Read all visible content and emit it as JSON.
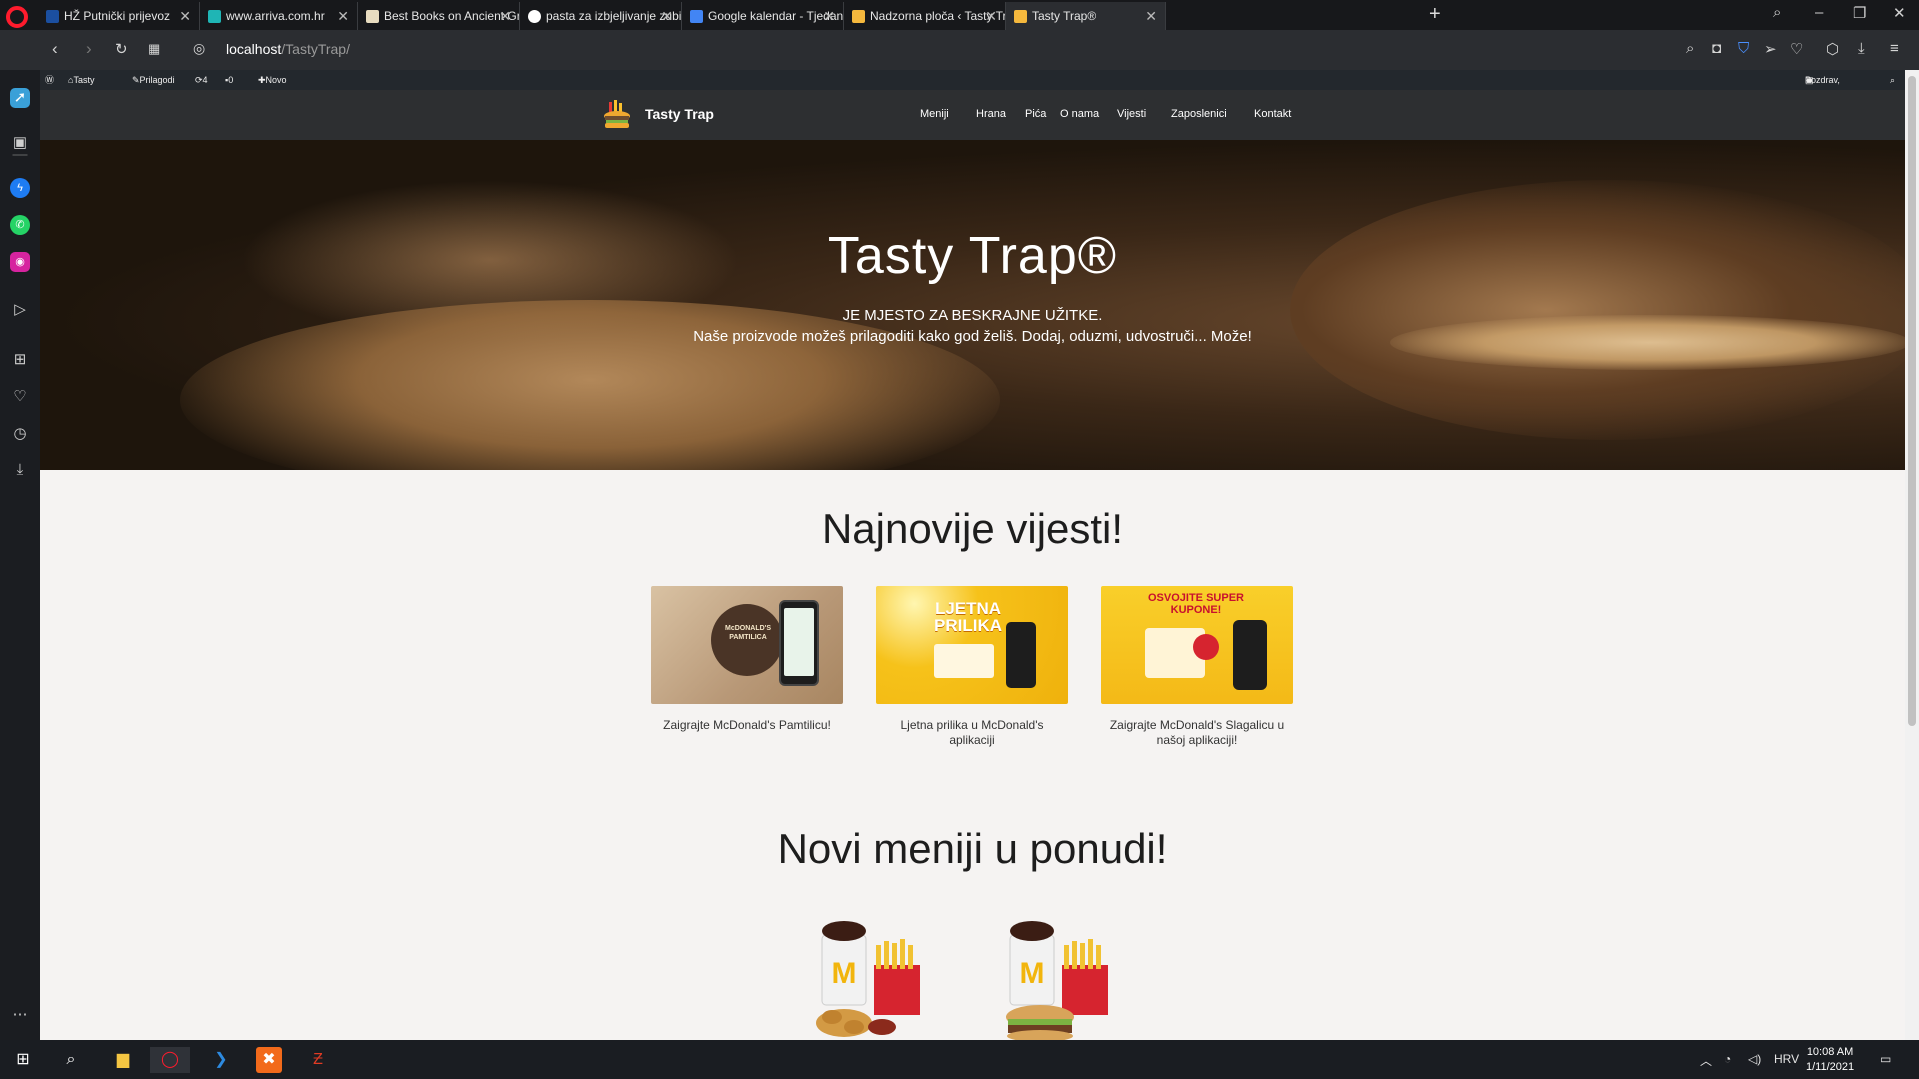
{
  "browser": {
    "tabs": [
      {
        "title": "HŽ Putnički prijevoz",
        "active": false
      },
      {
        "title": "www.arriva.com.hr",
        "active": false
      },
      {
        "title": "Best Books on Ancient Gre",
        "active": false
      },
      {
        "title": "pasta za izbjeljivanje zubi -",
        "active": false
      },
      {
        "title": "Google kalendar - Tjedan o",
        "active": false
      },
      {
        "title": "Nadzorna ploča ‹ Tasty Trap",
        "active": false
      },
      {
        "title": "Tasty Trap®",
        "active": true
      }
    ],
    "url_host": "localhost",
    "url_path": "/TastyTrap/",
    "colors": {
      "brand": "#ff1b2d",
      "tabbar": "#17181b",
      "toolbar": "#2b2d31"
    }
  },
  "wp_admin_bar": {
    "site_name": "Tasty Trap",
    "customize": "Prilagodi",
    "updates": "4",
    "comments": "0",
    "new": "Novo",
    "greeting": "Pozdrav, admin"
  },
  "site": {
    "logo_text": "Tasty Trap",
    "menu": [
      "Meniji",
      "Hrana",
      "Pića",
      "O nama",
      "Vijesti",
      "Zaposlenici",
      "Kontakt"
    ],
    "hero": {
      "title": "Tasty Trap®",
      "subtitle": "JE MJESTO ZA BESKRAJNE UŽITKE.",
      "text": "Naše proizvode možeš prilagoditi kako god želiš. Dodaj, oduzmi, udvostruči... Može!"
    },
    "news_heading": "Najnovije vijesti!",
    "news": [
      {
        "caption": "Zaigrajte McDonald's Pamtilicu!",
        "image_text": "McDONALD'S PAMTILICA"
      },
      {
        "caption": "Ljetna prilika u McDonald's aplikaciji",
        "image_text": "LJETNA PRILIKA"
      },
      {
        "caption": "Zaigrajte McDonald's Slagalicu u našoj aplikaciji!",
        "image_text": "OSVOJITE SUPER KUPONE!"
      }
    ],
    "menus_heading": "Novi meniji u ponudi!",
    "colors": {
      "nav": "#2d2f31",
      "page_bg": "#f5f3f2",
      "promo_yellow": "#f6c21a"
    }
  },
  "taskbar": {
    "language": "HRV",
    "time": "10:08 AM",
    "date": "1/11/2021"
  }
}
